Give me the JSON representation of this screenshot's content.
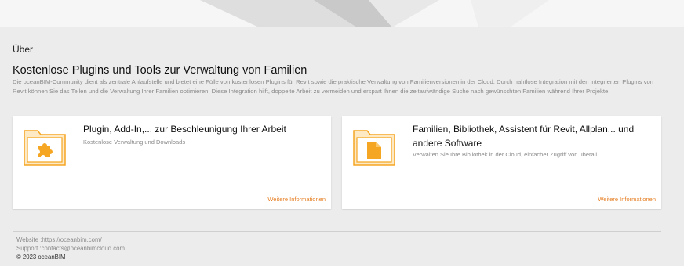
{
  "banner": {
    "colors": {
      "bg": "#f6f6f6",
      "shape_light": "#dedede",
      "shape_dark": "#c9c9c9"
    }
  },
  "about": {
    "section_title": "Über",
    "headline": "Kostenlose Plugins und Tools zur Verwaltung von Familien",
    "intro": "Die oceanBIM-Community dient als zentrale Anlaufstelle und bietet eine Fülle von kostenlosen Plugins für Revit sowie die praktische Verwaltung von Familienversionen in der Cloud. Durch nahtlose Integration mit den integrierten Plugins von Revit können Sie das Teilen und die Verwaltung Ihrer Familien optimieren. Diese Integration hilft, doppelte Arbeit zu vermeiden und erspart Ihnen die zeitaufwändige Suche nach gewünschten Familien während Ihrer Projekte."
  },
  "cards": [
    {
      "icon": "folder-puzzle-icon",
      "title": "Plugin, Add-In,... zur Beschleunigung Ihrer Arbeit",
      "subtitle": "Kostenlose Verwaltung und Downloads",
      "link": "Weitere Informationen"
    },
    {
      "icon": "folder-document-icon",
      "title": "Familien, Bibliothek, Assistent für Revit, Allplan... und andere Software",
      "subtitle": "Verwalten Sie Ihre Bibliothek in der Cloud, einfacher Zugriff von überall",
      "link": "Weitere Informationen"
    }
  ],
  "footer": {
    "website": "Website :https://oceanbim.com/",
    "support": "Support :contacts@oceanbimcloud.com",
    "copyright": "© 2023 oceanBIM"
  },
  "colors": {
    "accent": "#f5a623",
    "link": "#e67e22",
    "page_bg": "#ececec"
  }
}
